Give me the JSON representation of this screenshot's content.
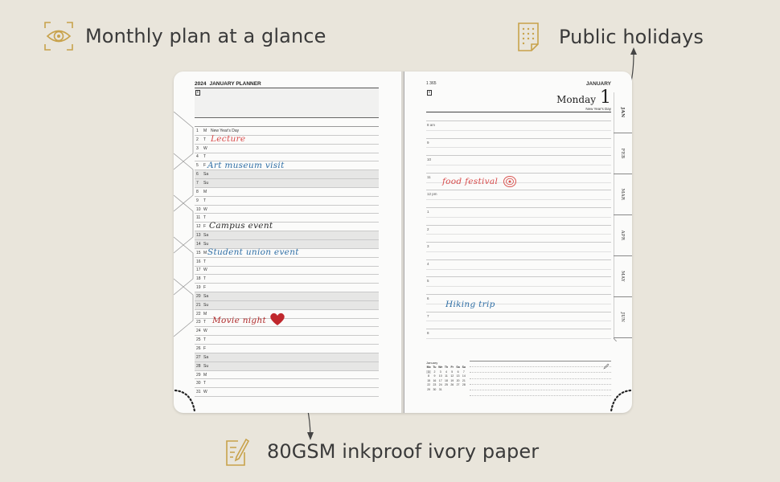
{
  "callouts": {
    "monthly": "Monthly plan at a glance",
    "holidays": "Public holidays",
    "paper": "80GSM inkproof ivory paper"
  },
  "icons": {
    "monthly": "eye-scan-icon",
    "holidays": "calendar-page-icon",
    "paper": "pencil-note-icon"
  },
  "colors": {
    "background": "#e9e5db",
    "icon_gold": "#c8a24b",
    "ink_red": "#d84a4a",
    "ink_blue": "#2f6fa6",
    "heart": "#c0282d"
  },
  "left_page": {
    "year": "2024",
    "title": "JANUARY PLANNER",
    "days": [
      {
        "n": "1",
        "w": "M",
        "h": "New Year's Day",
        "we": false
      },
      {
        "n": "2",
        "w": "T",
        "h": "",
        "we": false
      },
      {
        "n": "3",
        "w": "W",
        "h": "",
        "we": false
      },
      {
        "n": "4",
        "w": "T",
        "h": "",
        "we": false
      },
      {
        "n": "5",
        "w": "F",
        "h": "",
        "we": false
      },
      {
        "n": "6",
        "w": "Sa",
        "h": "",
        "we": true
      },
      {
        "n": "7",
        "w": "Su",
        "h": "",
        "we": true
      },
      {
        "n": "8",
        "w": "M",
        "h": "",
        "we": false
      },
      {
        "n": "9",
        "w": "T",
        "h": "",
        "we": false
      },
      {
        "n": "10",
        "w": "W",
        "h": "",
        "we": false
      },
      {
        "n": "11",
        "w": "T",
        "h": "",
        "we": false
      },
      {
        "n": "12",
        "w": "F",
        "h": "",
        "we": false
      },
      {
        "n": "13",
        "w": "Sa",
        "h": "",
        "we": true
      },
      {
        "n": "14",
        "w": "Su",
        "h": "",
        "we": true
      },
      {
        "n": "15",
        "w": "M",
        "h": "",
        "we": false
      },
      {
        "n": "16",
        "w": "T",
        "h": "",
        "we": false
      },
      {
        "n": "17",
        "w": "W",
        "h": "",
        "we": false
      },
      {
        "n": "18",
        "w": "T",
        "h": "",
        "we": false
      },
      {
        "n": "19",
        "w": "F",
        "h": "",
        "we": false
      },
      {
        "n": "20",
        "w": "Sa",
        "h": "",
        "we": true
      },
      {
        "n": "21",
        "w": "Su",
        "h": "",
        "we": true
      },
      {
        "n": "22",
        "w": "M",
        "h": "",
        "we": false
      },
      {
        "n": "23",
        "w": "T",
        "h": "",
        "we": false
      },
      {
        "n": "24",
        "w": "W",
        "h": "",
        "we": false
      },
      {
        "n": "25",
        "w": "T",
        "h": "",
        "we": false
      },
      {
        "n": "26",
        "w": "F",
        "h": "",
        "we": false
      },
      {
        "n": "27",
        "w": "Sa",
        "h": "",
        "we": true
      },
      {
        "n": "28",
        "w": "Su",
        "h": "",
        "we": true
      },
      {
        "n": "29",
        "w": "M",
        "h": "",
        "we": false
      },
      {
        "n": "30",
        "w": "T",
        "h": "",
        "we": false
      },
      {
        "n": "31",
        "w": "W",
        "h": "",
        "we": false
      }
    ],
    "handwriting": [
      {
        "text": "Lecture",
        "color": "red"
      },
      {
        "text": "Art museum visit",
        "color": "blue"
      },
      {
        "text": "Campus event",
        "color": "dark"
      },
      {
        "text": "Student union event",
        "color": "blue"
      },
      {
        "text": "Movie night",
        "color": "maroon"
      }
    ]
  },
  "right_page": {
    "month": "JANUARY",
    "day_index": "1 365",
    "weekday": "Monday",
    "date": "1",
    "holiday": "New Year's Day",
    "hours": [
      "8 am",
      "9",
      "10",
      "11",
      "12 pm",
      "1",
      "2",
      "3",
      "4",
      "5",
      "6",
      "7",
      "8"
    ],
    "handwriting": [
      {
        "text": "food festival",
        "color": "red"
      },
      {
        "text": "Hiking trip",
        "color": "blue"
      }
    ],
    "mini_calendar": {
      "title": "January",
      "head": [
        "Mo",
        "Tu",
        "We",
        "Th",
        "Fr",
        "Sa",
        "Su"
      ],
      "days": [
        "1",
        "2",
        "3",
        "4",
        "5",
        "6",
        "7",
        "8",
        "9",
        "10",
        "11",
        "12",
        "13",
        "14",
        "15",
        "16",
        "17",
        "18",
        "19",
        "20",
        "21",
        "22",
        "23",
        "24",
        "25",
        "26",
        "27",
        "28",
        "29",
        "30",
        "31"
      ]
    },
    "tabs": [
      "JAN",
      "FEB",
      "MAR",
      "APR",
      "MAY",
      "JUN"
    ]
  }
}
